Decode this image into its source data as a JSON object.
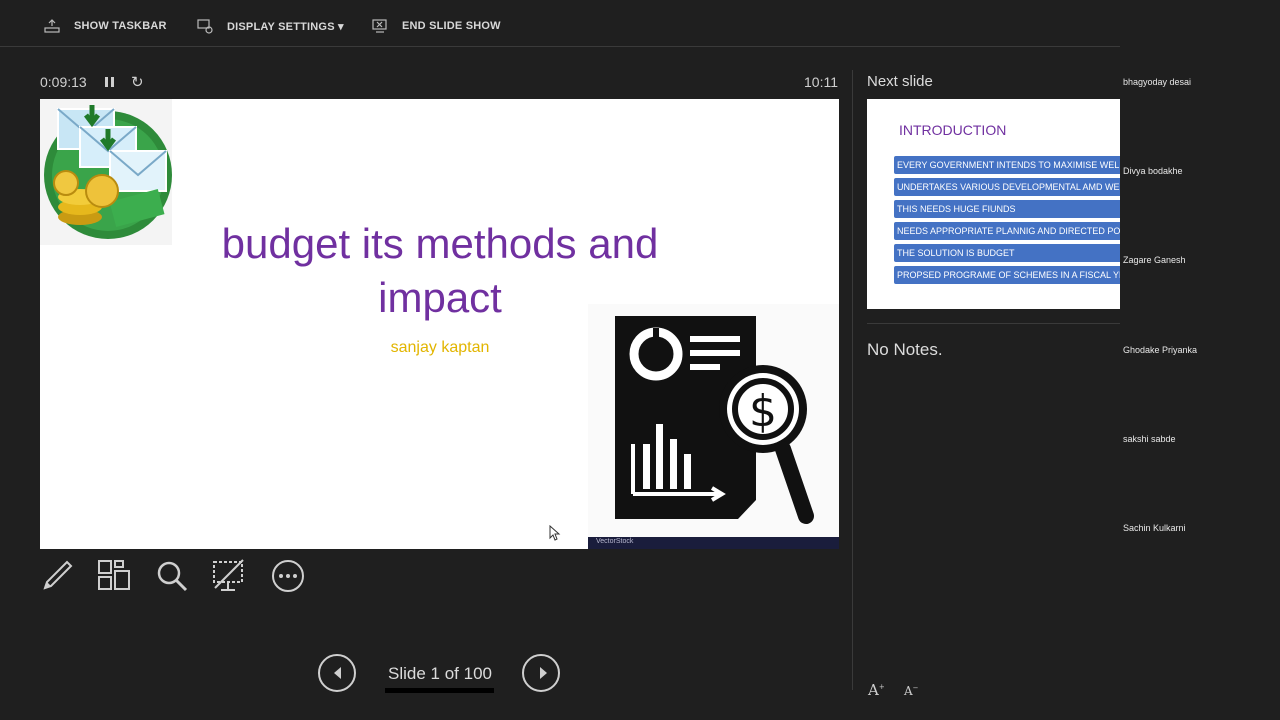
{
  "toolbar": {
    "show_taskbar": "SHOW TASKBAR",
    "display_settings": "DISPLAY SETTINGS ▾",
    "end_show": "END SLIDE SHOW"
  },
  "timer": {
    "elapsed": "0:09:13",
    "clock": "10:11"
  },
  "slide": {
    "title_line1": "budget its methods and",
    "title_line2": "impact",
    "subtitle": "sanjay kaptan",
    "image_credit": "VectorStock"
  },
  "navigation": {
    "counter": "Slide 1 of 100"
  },
  "next_slide": {
    "label": "Next slide",
    "title": "INTRODUCTION",
    "bullets": [
      "EVERY GOVERNMENT INTENDS TO MAXIMISE WELFARE",
      "UNDERTAKES VARIOUS DEVELOPMENTAL AMD WELFARE",
      "THIS NEEDS HUGE FIUNDS",
      "NEEDS APPROPRIATE PLANNIG AND  DIRECTED POLICY",
      "THE SOLUTION IS BUDGET",
      "PROPSED PROGRAME OF SCHEMES IN A FISCAL YEAR"
    ]
  },
  "notes": {
    "text": "No Notes.",
    "increase_font": "A",
    "decrease_font": "A"
  },
  "participants": [
    "bhagyoday desai",
    "Divya bodakhe",
    "Zagare Ganesh",
    "Ghodake Priyanka",
    "sakshi sabde",
    "Sachin Kulkarni"
  ],
  "colors": {
    "title": "#7030a0",
    "subtitle": "#e2b500",
    "bullet_bg": "#4472c4",
    "background": "#1f1f1f"
  }
}
